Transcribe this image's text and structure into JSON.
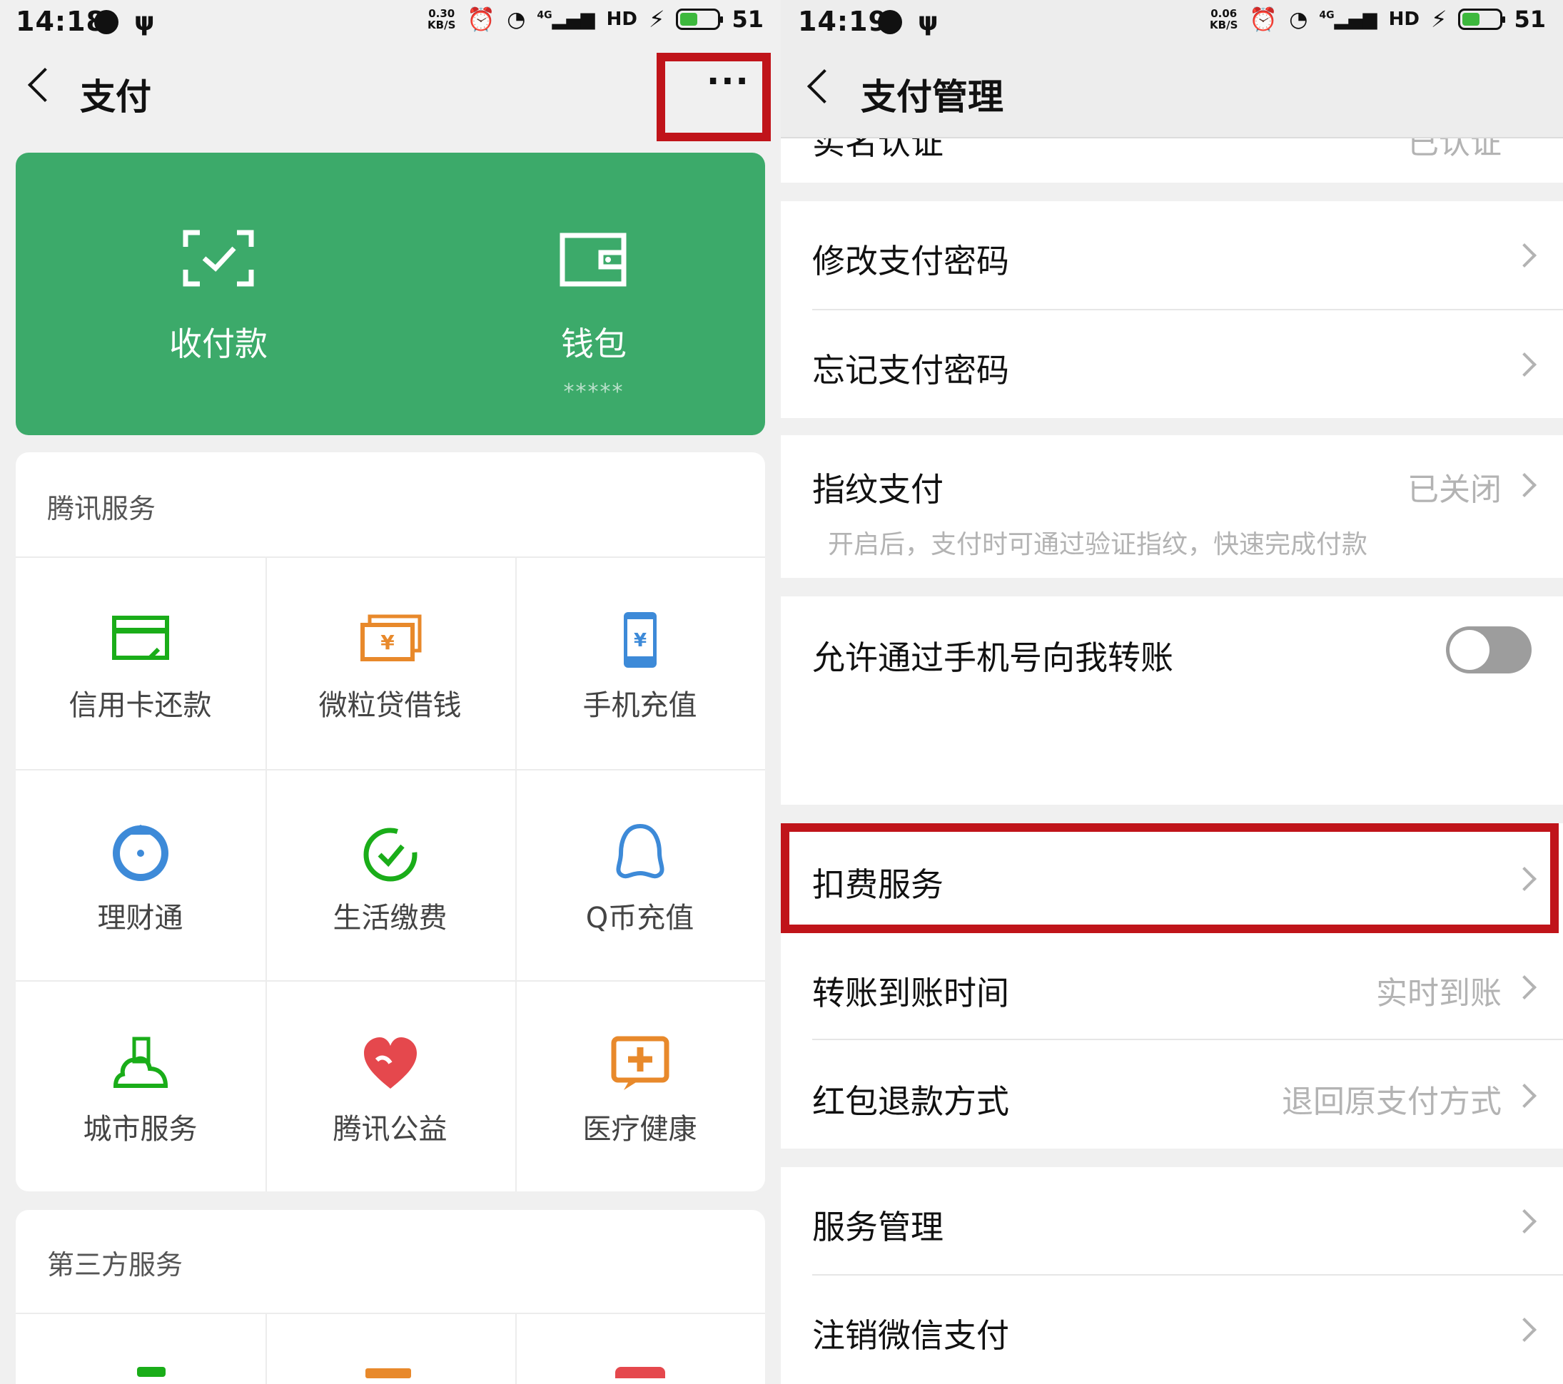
{
  "left": {
    "status": {
      "time": "14:18",
      "speed_value": "0.30",
      "speed_unit": "KB/S",
      "network": "4G",
      "hd": "HD",
      "battery": "51"
    },
    "nav": {
      "title": "支付",
      "more_label": "···"
    },
    "green_card": {
      "pay_label": "收付款",
      "wallet_label": "钱包",
      "wallet_balance_mask": "*****"
    },
    "tencent_services": {
      "title": "腾讯服务",
      "items": [
        {
          "label": "信用卡还款",
          "icon": "credit-card-icon",
          "color": "#1aad19"
        },
        {
          "label": "微粒贷借钱",
          "icon": "loan-cash-icon",
          "color": "#e8892b"
        },
        {
          "label": "手机充值",
          "icon": "phone-topup-icon",
          "color": "#3d8ad8"
        },
        {
          "label": "理财通",
          "icon": "wealth-icon",
          "color": "#3d8ad8"
        },
        {
          "label": "生活缴费",
          "icon": "bill-pay-icon",
          "color": "#1aad19"
        },
        {
          "label": "Q币充值",
          "icon": "qq-coin-icon",
          "color": "#3d8ad8"
        },
        {
          "label": "城市服务",
          "icon": "city-service-icon",
          "color": "#1aad19"
        },
        {
          "label": "腾讯公益",
          "icon": "charity-heart-icon",
          "color": "#e5484d"
        },
        {
          "label": "医疗健康",
          "icon": "medical-icon",
          "color": "#e8892b"
        }
      ]
    },
    "third_party": {
      "title": "第三方服务"
    }
  },
  "right": {
    "status": {
      "time": "14:19",
      "speed_value": "0.06",
      "speed_unit": "KB/S",
      "network": "4G",
      "hd": "HD",
      "battery": "51"
    },
    "nav": {
      "title": "支付管理"
    },
    "top_partial_label": "实名认证",
    "top_partial_value": "已认证",
    "rows": {
      "change_password": "修改支付密码",
      "forget_password": "忘记支付密码",
      "fingerprint": {
        "label": "指纹支付",
        "value": "已关闭",
        "desc": "开启后，支付时可通过验证指纹，快速完成付款"
      },
      "phone_transfer": {
        "label": "允许通过手机号向我转账",
        "enabled": false
      },
      "deduction": "扣费服务",
      "transfer_time": {
        "label": "转账到账时间",
        "value": "实时到账"
      },
      "redpacket_refund": {
        "label": "红包退款方式",
        "value": "退回原支付方式"
      },
      "service_manage": "服务管理",
      "cancel_wechat_pay": "注销微信支付"
    }
  },
  "colors": {
    "green": "#3caa6a",
    "highlight": "#c0141a",
    "toggle_off": "#9d9d9d"
  }
}
